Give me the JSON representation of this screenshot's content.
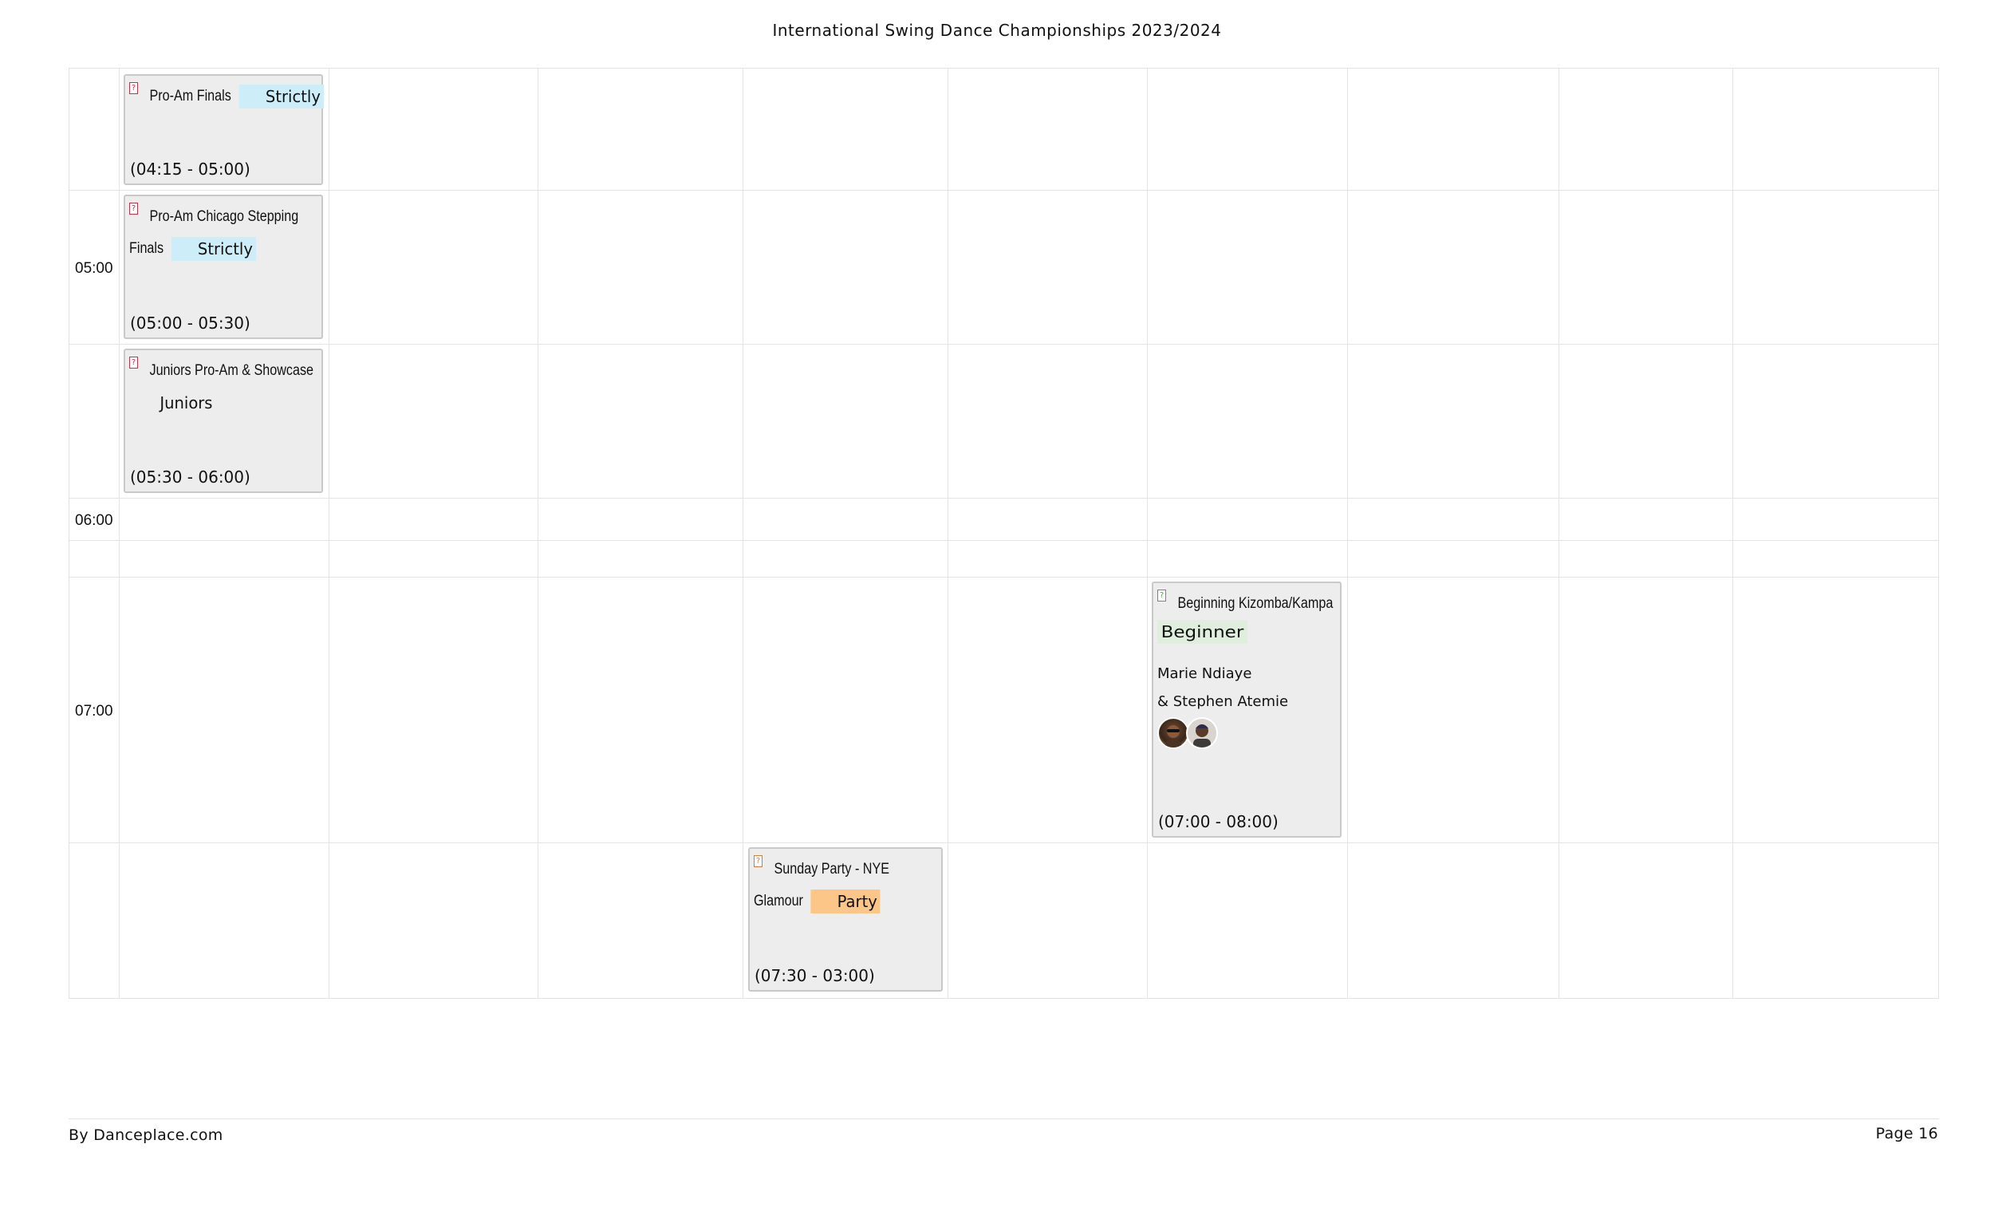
{
  "header": {
    "title": "International Swing Dance Championships 2023/2024"
  },
  "time_labels": [
    "05:00",
    "06:00",
    "07:00"
  ],
  "colors": {
    "tag_strictly": "#cdeef9",
    "tag_juniors": "#ededed",
    "tag_beginner": "#dfeedd",
    "tag_party": "#fcc689",
    "icon_red": "#c0354a",
    "icon_green": "#5a9e4e",
    "icon_orange": "#e07a2e"
  },
  "events": [
    {
      "name": "Pro-Am Finals",
      "tag": "Strictly",
      "time": "(04:15 - 05:00)",
      "icon": "category-icon-red"
    },
    {
      "name": "Pro-Am Chicago Stepping Finals",
      "tag": "Strictly",
      "time": "(05:00 - 05:30)",
      "icon": "category-icon-red"
    },
    {
      "name": "Juniors Pro-Am & Showcase",
      "tag": "Juniors",
      "time": "(05:30 - 06:00)",
      "icon": "category-icon-red"
    },
    {
      "name": "Beginning Kizomba/Kampa",
      "tag": "Beginner",
      "teachers_line1": "Marie Ndiaye",
      "teachers_line2": "& Stephen Atemie",
      "time": "(07:00 - 08:00)",
      "icon": "category-icon-green"
    },
    {
      "name": "Sunday Party - NYE Glamour",
      "tag": "Party",
      "time": "(07:30 - 03:00)",
      "icon": "category-icon-orange"
    }
  ],
  "footer": {
    "left": "By Danceplace.com",
    "right": "Page 16"
  }
}
